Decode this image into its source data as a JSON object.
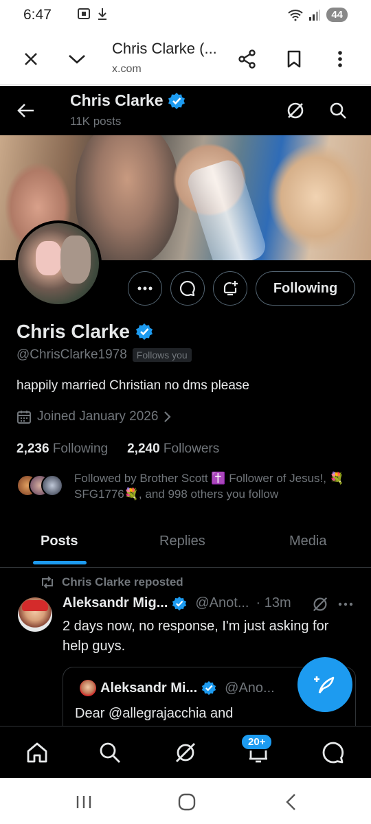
{
  "status_bar": {
    "time": "6:47",
    "battery": "44"
  },
  "browser_tab": {
    "title": "Chris Clarke (...",
    "url": "x.com"
  },
  "profile_header": {
    "name": "Chris Clarke",
    "post_count": "11K posts"
  },
  "profile": {
    "display_name": "Chris Clarke",
    "handle": "@ChrisClarke1978",
    "follows_you": "Follows you",
    "bio": "happily married Christian no dms please",
    "joined": "Joined January 2026",
    "following_count": "2,236",
    "following_label": "Following",
    "followers_count": "2,240",
    "followers_label": "Followers",
    "followed_by_text": "Followed by Brother Scott ✝️ Follower of Jesus!, 💐SFG1776💐, and 998 others you follow",
    "follow_button": "Following"
  },
  "tabs": [
    {
      "label": "Posts",
      "active": true
    },
    {
      "label": "Replies",
      "active": false
    },
    {
      "label": "Media",
      "active": false
    }
  ],
  "tweet": {
    "repost_label": "Chris Clarke reposted",
    "author": "Aleksandr Mig...",
    "handle": "@Anot...",
    "time": "· 13m",
    "text": "2 days now, no response, I'm just asking for help guys.",
    "quote": {
      "author": "Aleksandr Mi...",
      "handle": "@Ano...",
      "text": "Dear @allegrajacchia and"
    }
  },
  "bottom_nav": {
    "notifications_badge": "20+"
  },
  "colors": {
    "accent": "#1d9bf0",
    "background": "#000000",
    "muted": "#71767b",
    "text": "#e7e9ea"
  }
}
